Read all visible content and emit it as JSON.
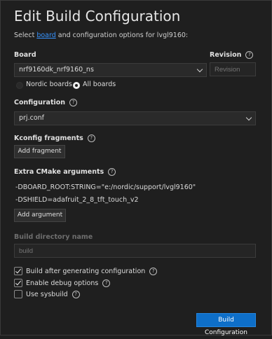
{
  "header": {
    "title": "Edit Build Configuration",
    "subtitle_prefix": "Select ",
    "subtitle_link": "board",
    "subtitle_suffix": " and configuration options for lvgl9160:"
  },
  "board": {
    "label": "Board",
    "value": "nrf9160dk_nrf9160_ns",
    "radios": [
      {
        "label": "Nordic boards",
        "checked": false
      },
      {
        "label": "All boards",
        "checked": true
      }
    ]
  },
  "revision": {
    "label": "Revision",
    "placeholder": "Revision"
  },
  "configuration": {
    "label": "Configuration",
    "value": "prj.conf"
  },
  "kconfig": {
    "label": "Kconfig fragments",
    "add_label": "Add fragment"
  },
  "cmake": {
    "label": "Extra CMake arguments",
    "args": [
      "-DBOARD_ROOT:STRING=\"e:/nordic/support/lvgl9160\"",
      "-DSHIELD=adafruit_2_8_tft_touch_v2"
    ],
    "add_label": "Add argument"
  },
  "build_dir": {
    "label": "Build directory name",
    "placeholder": "build"
  },
  "options": [
    {
      "label": "Build after generating configuration",
      "checked": true
    },
    {
      "label": "Enable debug options",
      "checked": true
    },
    {
      "label": "Use sysbuild",
      "checked": false
    }
  ],
  "footer": {
    "primary_label": "Build Configuration"
  },
  "colors": {
    "background": "#1f1f1f",
    "accent": "#0e6fc9",
    "link": "#3794ff"
  }
}
